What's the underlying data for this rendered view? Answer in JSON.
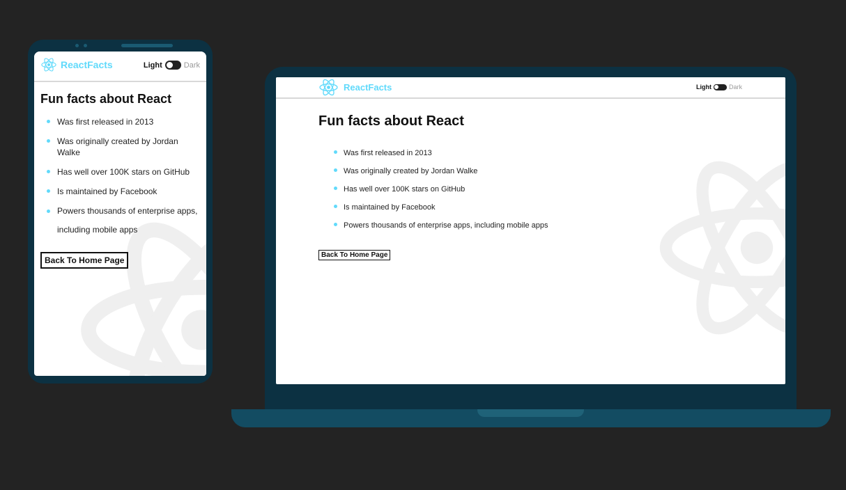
{
  "app": {
    "brand": "ReactFacts",
    "toggle": {
      "light_label": "Light",
      "dark_label": "Dark"
    },
    "title": "Fun facts about React",
    "facts": [
      "Was first released in 2013",
      "Was originally created by Jordan Walke",
      "Has well over 100K stars on GitHub",
      "Is maintained by Facebook",
      "Powers thousands of enterprise apps, including mobile apps"
    ],
    "mobile_last_fact": [
      "Powers thousands of enterprise apps,",
      "including mobile apps"
    ],
    "button_label": "Back To Home Page"
  },
  "colors": {
    "background": "#232323",
    "device": "#0c3142",
    "device_base": "#134c62",
    "accent": "#61dafb",
    "watermark": "#efefef"
  },
  "icons": {
    "logo": "react-logo-icon",
    "watermark": "react-atom-watermark-icon"
  }
}
